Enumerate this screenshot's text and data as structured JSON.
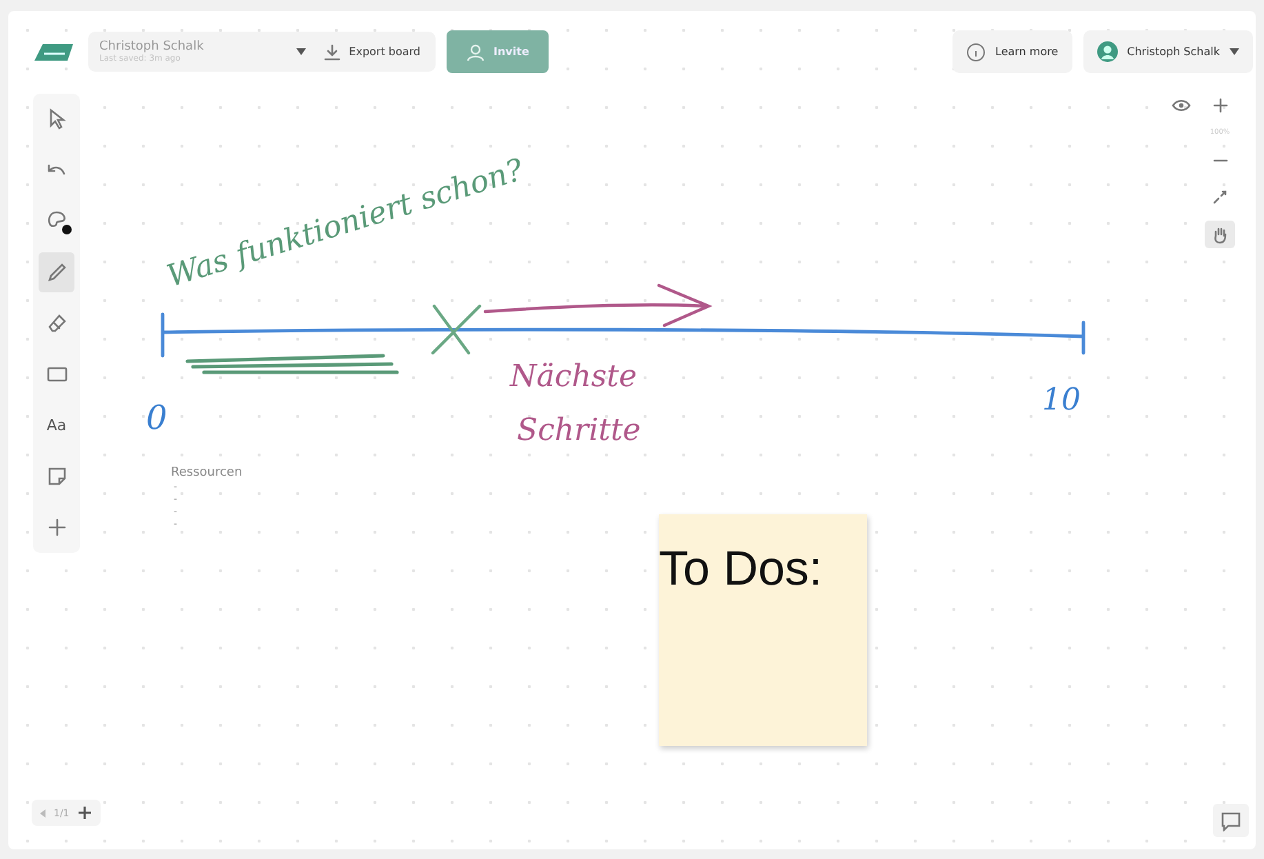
{
  "board": {
    "owner": "Christoph Schalk",
    "saved": "Last saved: 3m ago"
  },
  "topbar": {
    "export": "Export board",
    "invite": "Invite",
    "learn": "Learn more",
    "user": "Christoph Schalk"
  },
  "tools": [
    {
      "kind": "select",
      "selected": false
    },
    {
      "kind": "undo",
      "selected": false
    },
    {
      "kind": "color",
      "selected": false,
      "color": "#111111"
    },
    {
      "kind": "pen",
      "selected": true
    },
    {
      "kind": "eraser",
      "selected": false
    },
    {
      "kind": "shape",
      "selected": false
    },
    {
      "kind": "text",
      "selected": false,
      "label": "Aa"
    },
    {
      "kind": "note",
      "selected": false
    },
    {
      "kind": "add",
      "selected": false
    }
  ],
  "zoom": {
    "level_text": "100%"
  },
  "canvas": {
    "handwriting": [
      {
        "text": "Was funktioniert schon?",
        "color": "#5a9a78"
      },
      {
        "text": "0",
        "color": "#3a7fd0"
      },
      {
        "text": "Nächste",
        "color": "#b0588a"
      },
      {
        "text": "Schritte",
        "color": "#b0588a"
      },
      {
        "text": "10",
        "color": "#3a7fd0"
      }
    ],
    "list": {
      "title": "Ressourcen",
      "items": [
        "-",
        "-",
        "-",
        "-"
      ]
    },
    "sticky": {
      "text": "To Dos:"
    }
  },
  "pages": {
    "label": "1/1"
  }
}
